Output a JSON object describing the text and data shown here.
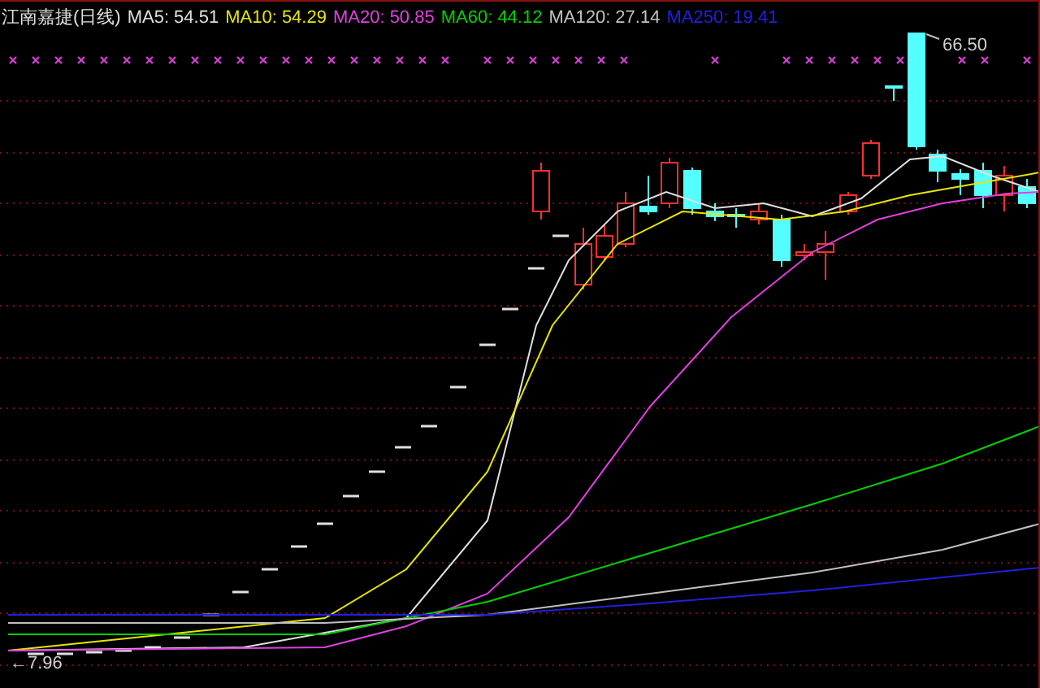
{
  "title": "江南嘉捷(日线)",
  "indicators": [
    {
      "label": "MA5: 54.51",
      "color": "#e0e0e0"
    },
    {
      "label": "MA10: 54.29",
      "color": "#e6e600"
    },
    {
      "label": "MA20: 50.85",
      "color": "#e040e0"
    },
    {
      "label": "MA60: 44.12",
      "color": "#00d000"
    },
    {
      "label": "MA120: 27.14",
      "color": "#c0c0c0"
    },
    {
      "label": "MA250: 19.41",
      "color": "#2020e0"
    }
  ],
  "chart": {
    "high_label": "66.50",
    "low_label": "←7.96"
  }
}
